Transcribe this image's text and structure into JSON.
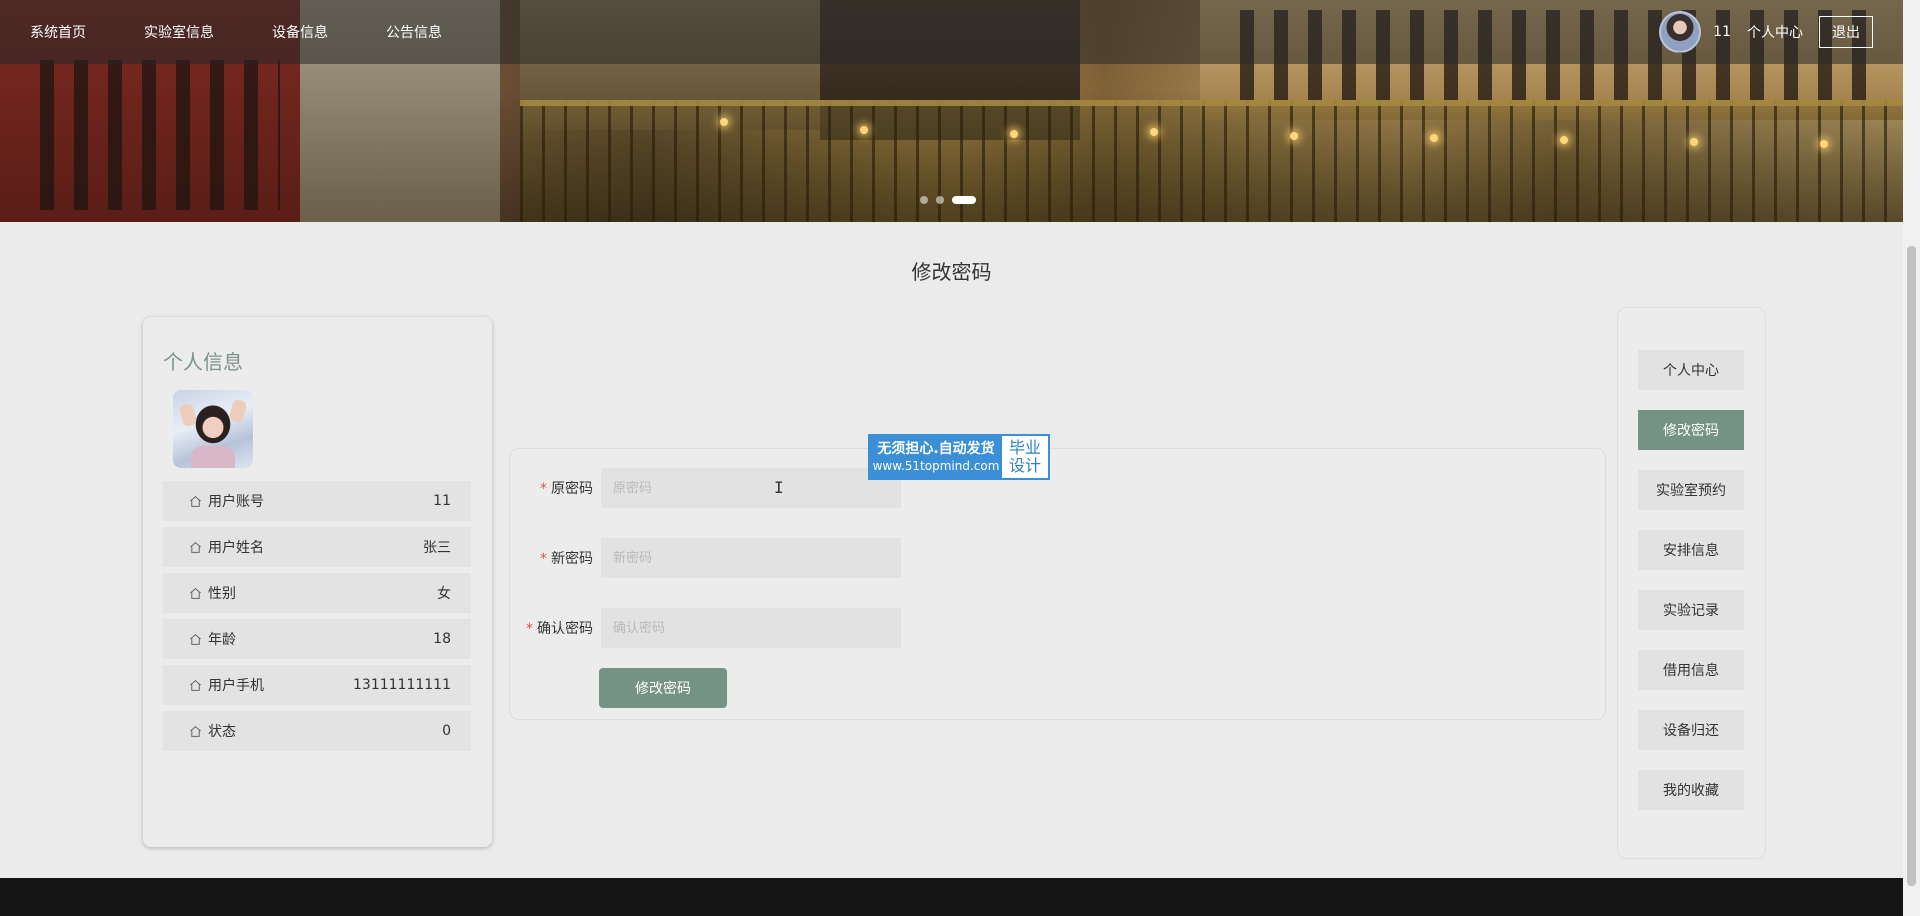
{
  "nav": {
    "items": [
      "系统首页",
      "实验室信息",
      "设备信息",
      "公告信息"
    ],
    "username": "11",
    "center_link": "个人中心",
    "logout": "退出"
  },
  "page_title": "修改密码",
  "info": {
    "heading": "个人信息",
    "rows": [
      {
        "label": "用户账号",
        "value": "11"
      },
      {
        "label": "用户姓名",
        "value": "张三"
      },
      {
        "label": "性别",
        "value": "女"
      },
      {
        "label": "年龄",
        "value": "18"
      },
      {
        "label": "用户手机",
        "value": "13111111111"
      },
      {
        "label": "状态",
        "value": "0"
      }
    ]
  },
  "form": {
    "fields": [
      {
        "label": "原密码",
        "placeholder": "原密码",
        "value": ""
      },
      {
        "label": "新密码",
        "placeholder": "新密码",
        "value": ""
      },
      {
        "label": "确认密码",
        "placeholder": "确认密码",
        "value": ""
      }
    ],
    "submit": "修改密码",
    "required_mark": "*"
  },
  "watermark": {
    "line1": "无须担心.自动发货",
    "line2": "www.51topmind.com",
    "right1": "毕业",
    "right2": "设计"
  },
  "side_menu": {
    "items": [
      "个人中心",
      "修改密码",
      "实验室预约",
      "安排信息",
      "实验记录",
      "借用信息",
      "设备归还",
      "我的收藏"
    ],
    "active_index": 1
  },
  "colors": {
    "accent": "#749384",
    "heading": "#7b9489",
    "required": "#e2534b"
  },
  "icons": {
    "info_row": "home-icon"
  }
}
